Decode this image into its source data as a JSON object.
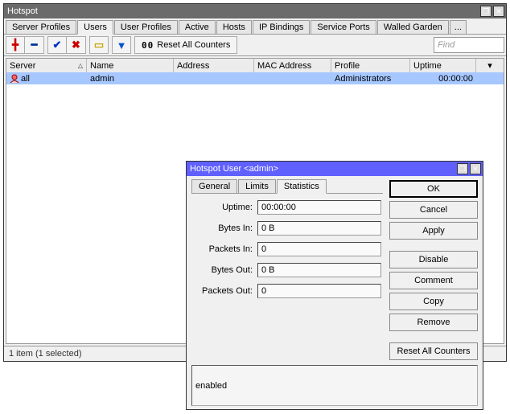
{
  "main": {
    "title": "Hotspot",
    "tabs": [
      "Server Profiles",
      "Users",
      "User Profiles",
      "Active",
      "Hosts",
      "IP Bindings",
      "Service Ports",
      "Walled Garden"
    ],
    "tabs_more": "...",
    "active_tab": 1,
    "toolbar": {
      "reset_label": "Reset All Counters",
      "counter_prefix": "00"
    },
    "find_placeholder": "Find",
    "columns": [
      "Server",
      "Name",
      "Address",
      "MAC Address",
      "Profile",
      "Uptime"
    ],
    "row": {
      "server": "all",
      "name": "admin",
      "address": "",
      "mac": "",
      "profile": "Administrators",
      "uptime": "00:00:00"
    },
    "status": "1 item (1 selected)"
  },
  "sub": {
    "title": "Hotspot User <admin>",
    "tabs": [
      "General",
      "Limits",
      "Statistics"
    ],
    "active_tab": 2,
    "fields": {
      "uptime_label": "Uptime:",
      "uptime": "00:00:00",
      "bytes_in_label": "Bytes In:",
      "bytes_in": "0 B",
      "packets_in_label": "Packets In:",
      "packets_in": "0",
      "bytes_out_label": "Bytes Out:",
      "bytes_out": "0 B",
      "packets_out_label": "Packets Out:",
      "packets_out": "0"
    },
    "buttons": {
      "ok": "OK",
      "cancel": "Cancel",
      "apply": "Apply",
      "disable": "Disable",
      "comment": "Comment",
      "copy": "Copy",
      "remove": "Remove",
      "reset": "Reset All Counters"
    },
    "status": "enabled"
  }
}
